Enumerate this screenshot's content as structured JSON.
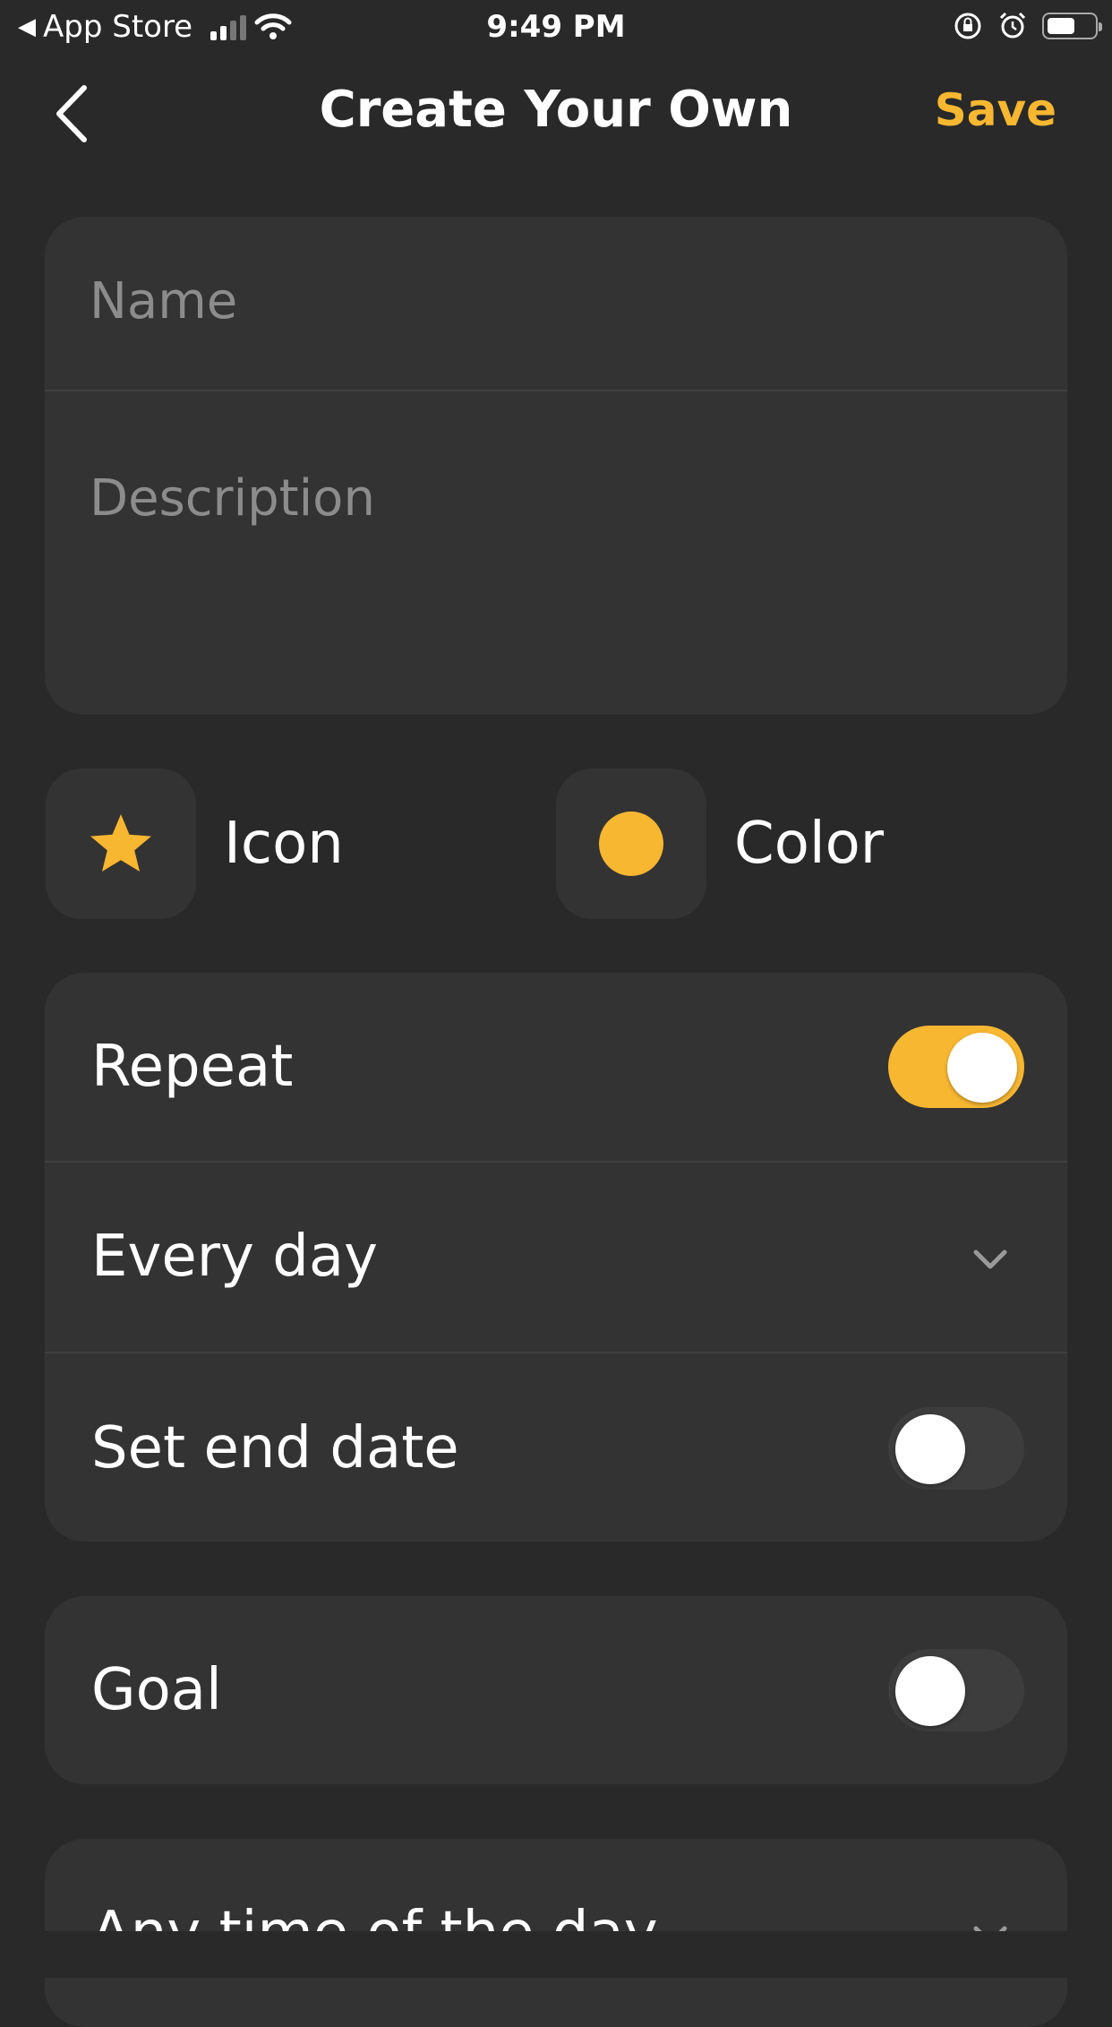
{
  "status_bar": {
    "back_app": "App Store",
    "time": "9:49 PM"
  },
  "nav": {
    "title": "Create Your Own",
    "save_label": "Save"
  },
  "form": {
    "name_placeholder": "Name",
    "description_placeholder": "Description"
  },
  "appearance": {
    "icon_label": "Icon",
    "icon_name": "star-icon",
    "color_label": "Color",
    "selected_color": "#f7b731"
  },
  "schedule": {
    "repeat_label": "Repeat",
    "repeat_on": true,
    "frequency_value": "Every day",
    "end_date_label": "Set end date",
    "end_date_on": false
  },
  "goal": {
    "label": "Goal",
    "on": false
  },
  "time_of_day": {
    "value": "Any time of the day"
  },
  "colors": {
    "accent": "#f7b731",
    "background": "#292929",
    "card": "#333333"
  }
}
